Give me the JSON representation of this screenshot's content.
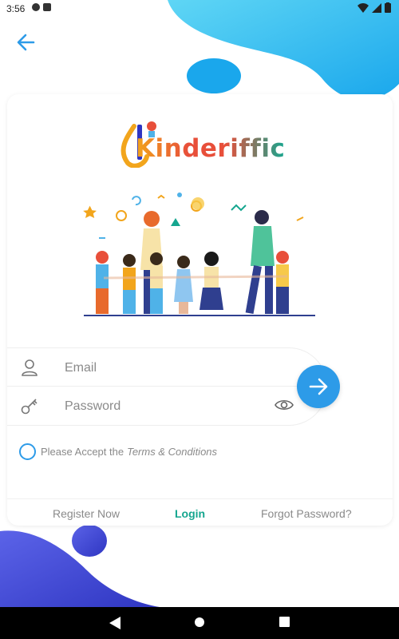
{
  "status_bar": {
    "time": "3:56"
  },
  "brand": {
    "logo_text": "Kinderiffic",
    "colors": {
      "accent_blue": "#2d9be8",
      "login_teal": "#15a68f",
      "blob_cyan": "#3cc8f0",
      "blob_indigo": "#4a4fd6"
    }
  },
  "form": {
    "email_placeholder": "Email",
    "password_placeholder": "Password"
  },
  "terms": {
    "prefix": "Please Accept the",
    "link": "Terms & Conditions"
  },
  "bottom_nav": {
    "register": "Register Now",
    "login": "Login",
    "forgot": "Forgot Password?"
  },
  "icons": {
    "back": "arrow-left-icon",
    "email": "user-icon",
    "password": "key-icon",
    "visibility": "eye-icon",
    "submit": "arrow-right-icon"
  }
}
